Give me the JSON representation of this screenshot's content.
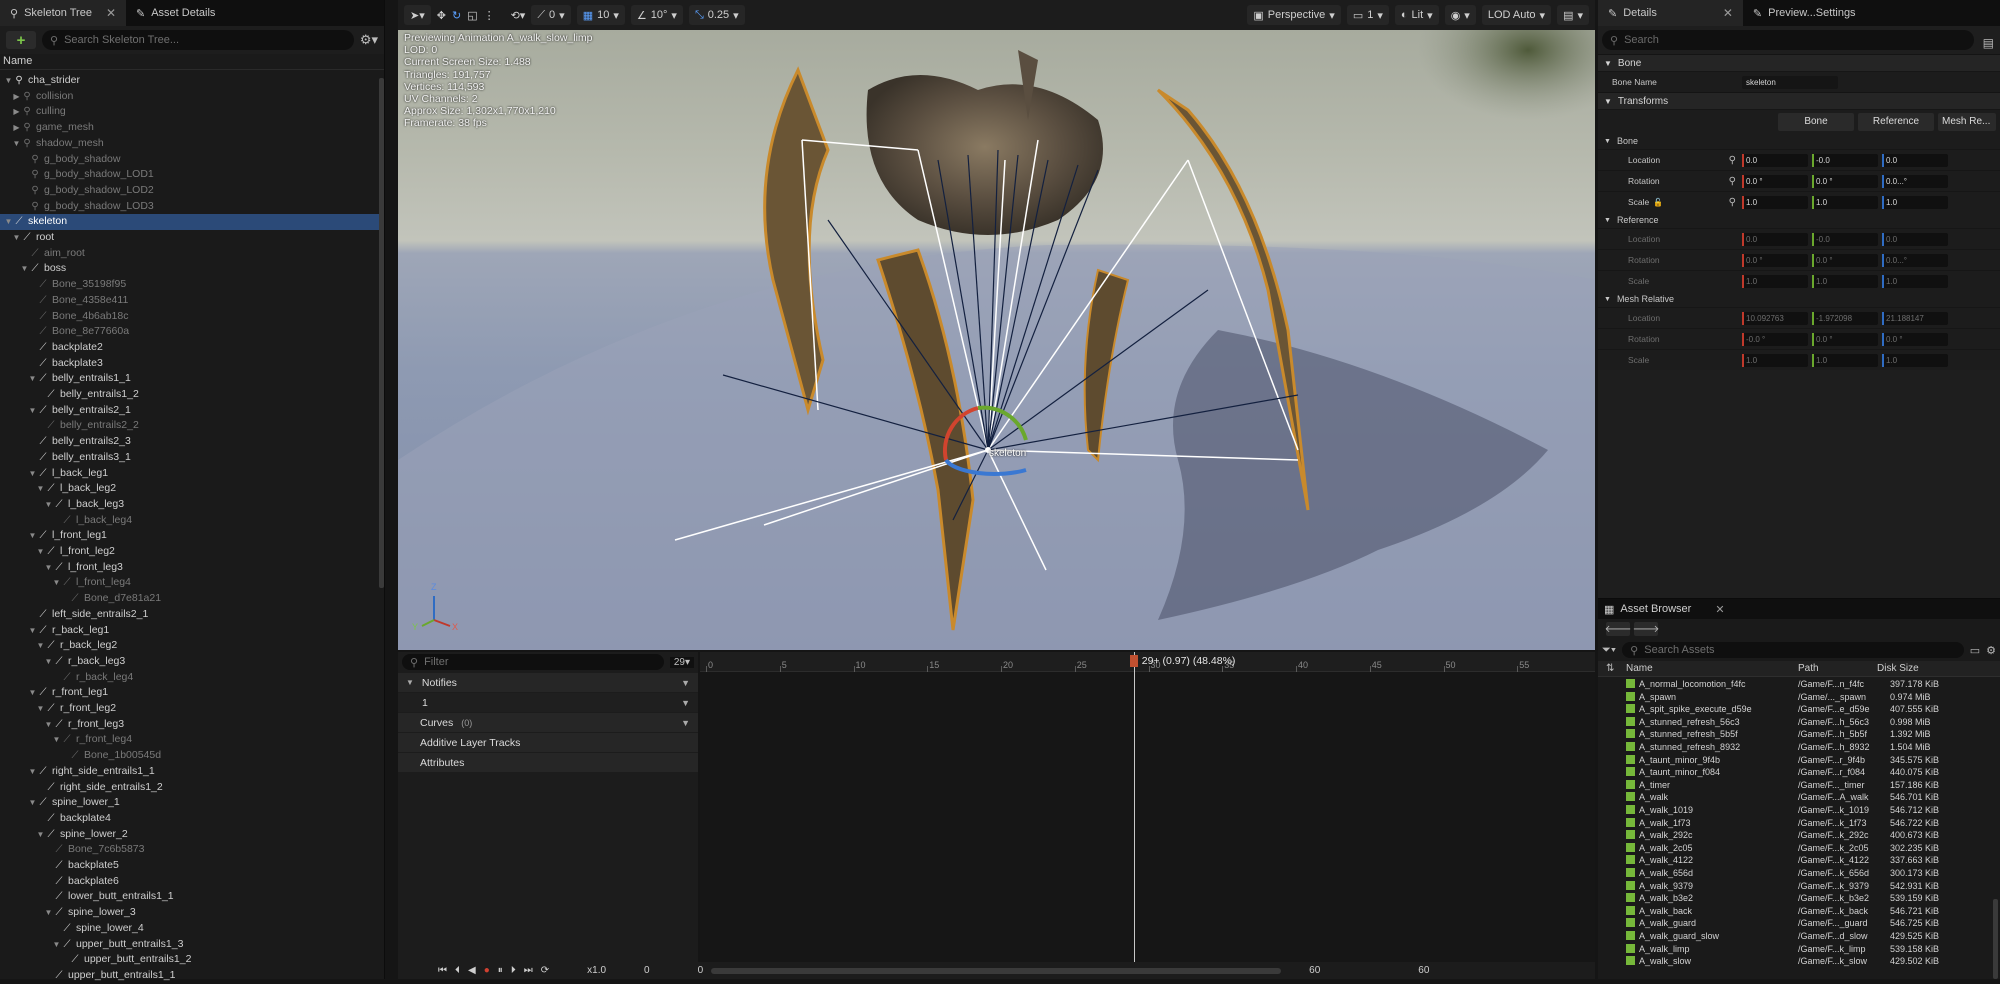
{
  "left_panel": {
    "tabs": [
      {
        "label": "Skeleton Tree",
        "active": true
      },
      {
        "label": "Asset Details",
        "active": false
      }
    ],
    "search_placeholder": "Search Skeleton Tree...",
    "column_name": "Name",
    "tree": [
      {
        "label": "cha_strider",
        "depth": 0,
        "kind": "mesh",
        "expanded": true
      },
      {
        "label": "collision",
        "depth": 1,
        "kind": "mesh",
        "dim": true,
        "collapsed": true
      },
      {
        "label": "culling",
        "depth": 1,
        "kind": "mesh",
        "dim": true,
        "collapsed": true
      },
      {
        "label": "game_mesh",
        "depth": 1,
        "kind": "mesh",
        "dim": true,
        "collapsed": true
      },
      {
        "label": "shadow_mesh",
        "depth": 1,
        "kind": "mesh",
        "dim": true,
        "expanded": true
      },
      {
        "label": "g_body_shadow",
        "depth": 2,
        "kind": "mesh",
        "dim": true
      },
      {
        "label": "g_body_shadow_LOD1",
        "depth": 2,
        "kind": "mesh",
        "dim": true
      },
      {
        "label": "g_body_shadow_LOD2",
        "depth": 2,
        "kind": "mesh",
        "dim": true
      },
      {
        "label": "g_body_shadow_LOD3",
        "depth": 2,
        "kind": "mesh",
        "dim": true
      },
      {
        "label": "skeleton",
        "depth": 0,
        "kind": "bone",
        "expanded": true,
        "selected": true
      },
      {
        "label": "root",
        "depth": 1,
        "kind": "bone",
        "expanded": true
      },
      {
        "label": "aim_root",
        "depth": 2,
        "kind": "bone",
        "dim": true
      },
      {
        "label": "boss",
        "depth": 2,
        "kind": "bone",
        "expanded": true
      },
      {
        "label": "Bone_35198f95",
        "depth": 3,
        "kind": "bone",
        "dim": true
      },
      {
        "label": "Bone_4358e411",
        "depth": 3,
        "kind": "bone",
        "dim": true
      },
      {
        "label": "Bone_4b6ab18c",
        "depth": 3,
        "kind": "bone",
        "dim": true
      },
      {
        "label": "Bone_8e77660a",
        "depth": 3,
        "kind": "bone",
        "dim": true
      },
      {
        "label": "backplate2",
        "depth": 3,
        "kind": "bone"
      },
      {
        "label": "backplate3",
        "depth": 3,
        "kind": "bone"
      },
      {
        "label": "belly_entrails1_1",
        "depth": 3,
        "kind": "bone",
        "expanded": true
      },
      {
        "label": "belly_entrails1_2",
        "depth": 4,
        "kind": "bone"
      },
      {
        "label": "belly_entrails2_1",
        "depth": 3,
        "kind": "bone",
        "expanded": true
      },
      {
        "label": "belly_entrails2_2",
        "depth": 4,
        "kind": "bone",
        "dim": true
      },
      {
        "label": "belly_entrails2_3",
        "depth": 3,
        "kind": "bone"
      },
      {
        "label": "belly_entrails3_1",
        "depth": 3,
        "kind": "bone"
      },
      {
        "label": "l_back_leg1",
        "depth": 3,
        "kind": "bone",
        "expanded": true
      },
      {
        "label": "l_back_leg2",
        "depth": 4,
        "kind": "bone",
        "expanded": true
      },
      {
        "label": "l_back_leg3",
        "depth": 5,
        "kind": "bone",
        "expanded": true
      },
      {
        "label": "l_back_leg4",
        "depth": 6,
        "kind": "bone",
        "dim": true
      },
      {
        "label": "l_front_leg1",
        "depth": 3,
        "kind": "bone",
        "expanded": true
      },
      {
        "label": "l_front_leg2",
        "depth": 4,
        "kind": "bone",
        "expanded": true
      },
      {
        "label": "l_front_leg3",
        "depth": 5,
        "kind": "bone",
        "expanded": true
      },
      {
        "label": "l_front_leg4",
        "depth": 6,
        "kind": "bone",
        "dim": true,
        "expanded": true
      },
      {
        "label": "Bone_d7e81a21",
        "depth": 7,
        "kind": "bone",
        "dim": true
      },
      {
        "label": "left_side_entrails2_1",
        "depth": 3,
        "kind": "bone"
      },
      {
        "label": "r_back_leg1",
        "depth": 3,
        "kind": "bone",
        "expanded": true
      },
      {
        "label": "r_back_leg2",
        "depth": 4,
        "kind": "bone",
        "expanded": true
      },
      {
        "label": "r_back_leg3",
        "depth": 5,
        "kind": "bone",
        "expanded": true
      },
      {
        "label": "r_back_leg4",
        "depth": 6,
        "kind": "bone",
        "dim": true
      },
      {
        "label": "r_front_leg1",
        "depth": 3,
        "kind": "bone",
        "expanded": true
      },
      {
        "label": "r_front_leg2",
        "depth": 4,
        "kind": "bone",
        "expanded": true
      },
      {
        "label": "r_front_leg3",
        "depth": 5,
        "kind": "bone",
        "expanded": true
      },
      {
        "label": "r_front_leg4",
        "depth": 6,
        "kind": "bone",
        "dim": true,
        "expanded": true
      },
      {
        "label": "Bone_1b00545d",
        "depth": 7,
        "kind": "bone",
        "dim": true
      },
      {
        "label": "right_side_entrails1_1",
        "depth": 3,
        "kind": "bone",
        "expanded": true
      },
      {
        "label": "right_side_entrails1_2",
        "depth": 4,
        "kind": "bone"
      },
      {
        "label": "spine_lower_1",
        "depth": 3,
        "kind": "bone",
        "expanded": true
      },
      {
        "label": "backplate4",
        "depth": 4,
        "kind": "bone"
      },
      {
        "label": "spine_lower_2",
        "depth": 4,
        "kind": "bone",
        "expanded": true
      },
      {
        "label": "Bone_7c6b5873",
        "depth": 5,
        "kind": "bone",
        "dim": true
      },
      {
        "label": "backplate5",
        "depth": 5,
        "kind": "bone"
      },
      {
        "label": "backplate6",
        "depth": 5,
        "kind": "bone"
      },
      {
        "label": "lower_butt_entrails1_1",
        "depth": 5,
        "kind": "bone"
      },
      {
        "label": "spine_lower_3",
        "depth": 5,
        "kind": "bone",
        "expanded": true
      },
      {
        "label": "spine_lower_4",
        "depth": 6,
        "kind": "bone"
      },
      {
        "label": "upper_butt_entrails1_3",
        "depth": 6,
        "kind": "bone",
        "expanded": true
      },
      {
        "label": "upper_butt_entrails1_2",
        "depth": 7,
        "kind": "bone"
      },
      {
        "label": "upper_butt_entrails1_1",
        "depth": 5,
        "kind": "bone"
      }
    ]
  },
  "viewport": {
    "toolbar": {
      "rotate_snap": "0",
      "grid_snap": "10",
      "angle_snap": "10°",
      "scale_snap": "0.25",
      "view_mode": "Perspective",
      "camera_speed": "1",
      "lighting": "Lit",
      "lod": "LOD Auto"
    },
    "stats": [
      "Previewing Animation A_walk_slow_limp",
      "LOD: 0",
      "Current Screen Size: 1.488",
      "Triangles: 191,757",
      "Vertices: 114,593",
      "UV Channels: 2",
      "Approx Size: 1,302x1,770x1,210",
      "Framerate: 38 fps"
    ],
    "bone_label": "skeleton",
    "axis": {
      "x": "X",
      "y": "Y",
      "z": "Z"
    }
  },
  "timeline": {
    "filter_placeholder": "Filter",
    "frame_field": "29",
    "tracks": [
      {
        "label": "Notifies",
        "header": true
      },
      {
        "label": "1",
        "header": false
      },
      {
        "label": "Curves",
        "count": "(0)",
        "header": true
      },
      {
        "label": "Additive Layer Tracks",
        "header": true
      },
      {
        "label": "Attributes",
        "header": true
      }
    ],
    "ticks": [
      "0",
      "5",
      "10",
      "15",
      "20",
      "25",
      "30",
      "35",
      "40",
      "45",
      "50",
      "55"
    ],
    "playhead_label": "29+ (0.97) (48.48%)",
    "playhead_frame": 29,
    "total_frames": 60,
    "speed": "x1.0",
    "transport_start": "0",
    "transport_mid": "0",
    "transport_end1": "60",
    "transport_end2": "60"
  },
  "details": {
    "tabs": [
      {
        "label": "Details",
        "active": true
      },
      {
        "label": "Preview...Settings",
        "active": false
      }
    ],
    "search_placeholder": "Search",
    "bone_section": "Bone",
    "bone_name_label": "Bone Name",
    "bone_name_value": "skeleton",
    "transforms_section": "Transforms",
    "space_buttons": [
      "Bone",
      "Reference",
      "Mesh Re..."
    ],
    "groups": [
      {
        "title": "Bone",
        "dim": false,
        "rows": [
          {
            "label": "Location",
            "x": "0.0",
            "y": "-0.0",
            "z": "0.0"
          },
          {
            "label": "Rotation",
            "x": "0.0 °",
            "y": "0.0 °",
            "z": "0.0...°"
          },
          {
            "label": "Scale",
            "x": "1.0",
            "y": "1.0",
            "z": "1.0"
          }
        ]
      },
      {
        "title": "Reference",
        "dim": true,
        "rows": [
          {
            "label": "Location",
            "x": "0.0",
            "y": "-0.0",
            "z": "0.0"
          },
          {
            "label": "Rotation",
            "x": "0.0 °",
            "y": "0.0 °",
            "z": "0.0...°"
          },
          {
            "label": "Scale",
            "x": "1.0",
            "y": "1.0",
            "z": "1.0"
          }
        ]
      },
      {
        "title": "Mesh Relative",
        "dim": true,
        "rows": [
          {
            "label": "Location",
            "x": "10.092763",
            "y": "-1.972098",
            "z": "21.188147"
          },
          {
            "label": "Rotation",
            "x": "-0.0 °",
            "y": "0.0 °",
            "z": "0.0 °"
          },
          {
            "label": "Scale",
            "x": "1.0",
            "y": "1.0",
            "z": "1.0"
          }
        ]
      }
    ]
  },
  "asset_browser": {
    "tab": "Asset Browser",
    "search_placeholder": "Search Assets",
    "columns": [
      "Name",
      "Path",
      "Disk Size"
    ],
    "rows": [
      {
        "name": "A_normal_locomotion_f4fc",
        "path": "/Game/F...n_f4fc",
        "size": "397.178 KiB"
      },
      {
        "name": "A_spawn",
        "path": "/Game/..._spawn",
        "size": "0.974 MiB"
      },
      {
        "name": "A_spit_spike_execute_d59e",
        "path": "/Game/F...e_d59e",
        "size": "407.555 KiB"
      },
      {
        "name": "A_stunned_refresh_56c3",
        "path": "/Game/F...h_56c3",
        "size": "0.998 MiB"
      },
      {
        "name": "A_stunned_refresh_5b5f",
        "path": "/Game/F...h_5b5f",
        "size": "1.392 MiB"
      },
      {
        "name": "A_stunned_refresh_8932",
        "path": "/Game/F...h_8932",
        "size": "1.504 MiB"
      },
      {
        "name": "A_taunt_minor_9f4b",
        "path": "/Game/F...r_9f4b",
        "size": "345.575 KiB"
      },
      {
        "name": "A_taunt_minor_f084",
        "path": "/Game/F...r_f084",
        "size": "440.075 KiB"
      },
      {
        "name": "A_timer",
        "path": "/Game/F..._timer",
        "size": "157.186 KiB"
      },
      {
        "name": "A_walk",
        "path": "/Game/F...A_walk",
        "size": "546.701 KiB"
      },
      {
        "name": "A_walk_1019",
        "path": "/Game/F...k_1019",
        "size": "546.712 KiB"
      },
      {
        "name": "A_walk_1f73",
        "path": "/Game/F...k_1f73",
        "size": "546.722 KiB"
      },
      {
        "name": "A_walk_292c",
        "path": "/Game/F...k_292c",
        "size": "400.673 KiB"
      },
      {
        "name": "A_walk_2c05",
        "path": "/Game/F...k_2c05",
        "size": "302.235 KiB"
      },
      {
        "name": "A_walk_4122",
        "path": "/Game/F...k_4122",
        "size": "337.663 KiB"
      },
      {
        "name": "A_walk_656d",
        "path": "/Game/F...k_656d",
        "size": "300.173 KiB"
      },
      {
        "name": "A_walk_9379",
        "path": "/Game/F...k_9379",
        "size": "542.931 KiB"
      },
      {
        "name": "A_walk_b3e2",
        "path": "/Game/F...k_b3e2",
        "size": "539.159 KiB"
      },
      {
        "name": "A_walk_back",
        "path": "/Game/F...k_back",
        "size": "546.721 KiB"
      },
      {
        "name": "A_walk_guard",
        "path": "/Game/F..._guard",
        "size": "546.725 KiB"
      },
      {
        "name": "A_walk_guard_slow",
        "path": "/Game/F...d_slow",
        "size": "429.525 KiB"
      },
      {
        "name": "A_walk_limp",
        "path": "/Game/F...k_limp",
        "size": "539.158 KiB"
      },
      {
        "name": "A_walk_slow",
        "path": "/Game/F...k_slow",
        "size": "429.502 KiB"
      }
    ]
  }
}
